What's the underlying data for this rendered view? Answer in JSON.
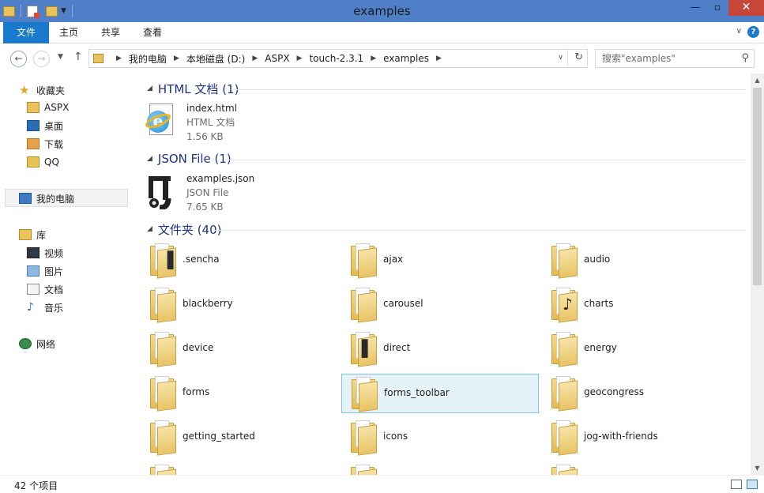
{
  "window": {
    "title": "examples"
  },
  "ribbon": {
    "tabs": [
      "文件",
      "主页",
      "共享",
      "查看"
    ]
  },
  "address": {
    "crumbs": [
      "我的电脑",
      "本地磁盘 (D:)",
      "ASPX",
      "touch-2.3.1",
      "examples"
    ],
    "search_placeholder": "搜索\"examples\""
  },
  "nav": {
    "favorites_label": "收藏夹",
    "favorites": [
      "ASPX",
      "桌面",
      "下载",
      "QQ"
    ],
    "pc_label": "我的电脑",
    "libraries_label": "库",
    "libraries": [
      "视频",
      "图片",
      "文档",
      "音乐"
    ],
    "network_label": "网络"
  },
  "groups": {
    "html": {
      "header": "HTML 文档 (1)",
      "file": {
        "name": "index.html",
        "type": "HTML 文档",
        "size": "1.56 KB",
        "icon": "ie-document-icon"
      }
    },
    "json": {
      "header": "JSON File (1)",
      "file": {
        "name": "examples.json",
        "type": "JSON File",
        "size": "7.65 KB",
        "icon": "json-file-icon"
      }
    },
    "folders": {
      "header": "文件夹 (40)",
      "items": [
        ".sencha",
        "ajax",
        "audio",
        "blackberry",
        "carousel",
        "charts",
        "device",
        "direct",
        "energy",
        "forms",
        "forms_toolbar",
        "geocongress",
        "getting_started",
        "icons",
        "jog-with-friends"
      ],
      "selected": "forms_toolbar"
    }
  },
  "status": {
    "count": "42 个项目"
  },
  "colors": {
    "titlebar": "#4f7fc6",
    "file_tab": "#1979ca",
    "group_header": "#1e3287",
    "selection": "#e5f3f9"
  }
}
